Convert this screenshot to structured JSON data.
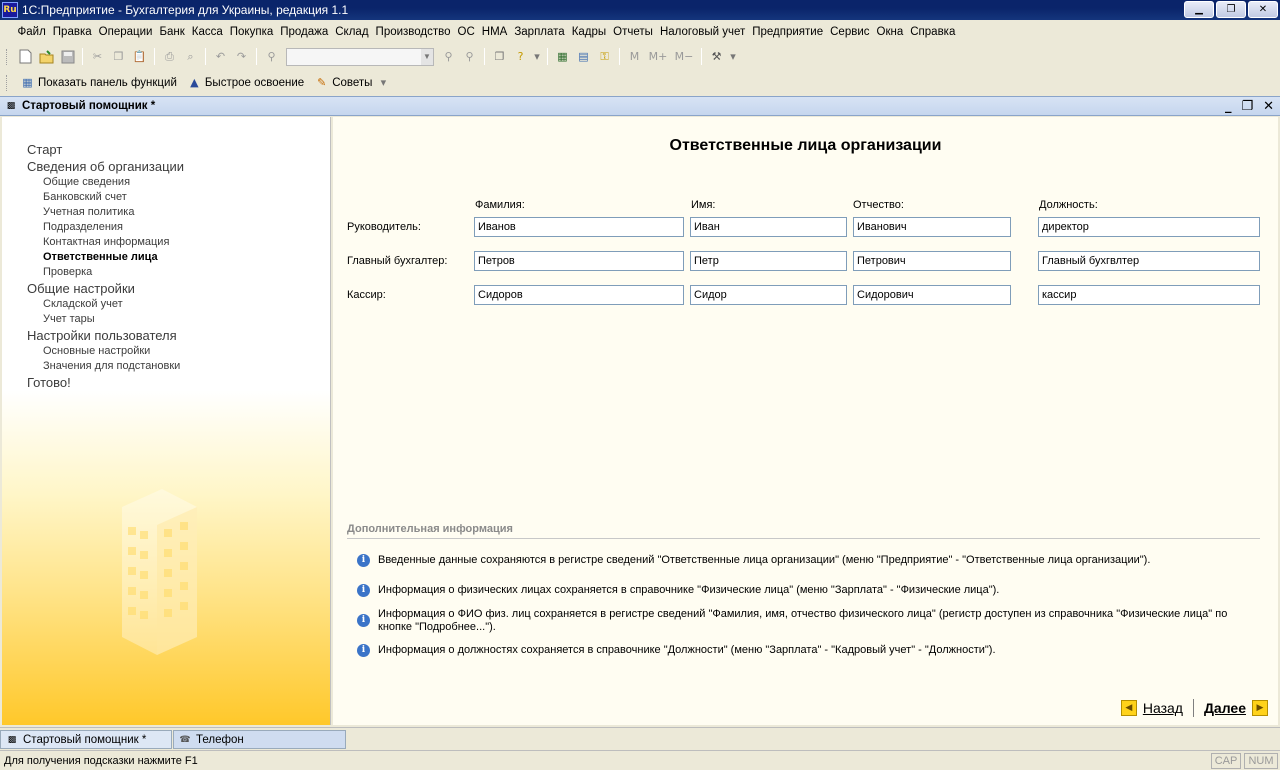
{
  "window": {
    "app_icon_text": "Ru",
    "title": "1С:Предприятие - Бухгалтерия для Украины, редакция 1.1"
  },
  "menu": [
    "Файл",
    "Правка",
    "Операции",
    "Банк",
    "Касса",
    "Покупка",
    "Продажа",
    "Склад",
    "Производство",
    "ОС",
    "НМА",
    "Зарплата",
    "Кадры",
    "Отчеты",
    "Налоговый учет",
    "Предприятие",
    "Сервис",
    "Окна",
    "Справка"
  ],
  "toolbar2": {
    "show_panel": "Показать панель функций",
    "quick_learning": "Быстрое освоение",
    "tips": "Советы"
  },
  "doc_window": {
    "title": "Стартовый помощник *"
  },
  "nav": {
    "start": "Старт",
    "org_info": "Сведения об организации",
    "general_info": "Общие сведения",
    "bank_account": "Банковский счет",
    "accounting_policy": "Учетная политика",
    "departments": "Подразделения",
    "contacts": "Контактная информация",
    "responsible": "Ответственные лица",
    "check": "Проверка",
    "general_settings": "Общие настройки",
    "warehouse": "Складской учет",
    "containers": "Учет тары",
    "user_settings": "Настройки пользователя",
    "basic_settings": "Основные настройки",
    "default_values": "Значения для подстановки",
    "done": "Готово!"
  },
  "main": {
    "title": "Ответственные лица организации",
    "columns": {
      "surname": "Фамилия:",
      "name": "Имя:",
      "patronymic": "Отчество:",
      "position": "Должность:"
    },
    "rows": {
      "director": {
        "label": "Руководитель:",
        "surname": "Иванов",
        "name": "Иван",
        "patronymic": "Иванович",
        "position": "директор"
      },
      "accountant": {
        "label": "Главный бухгалтер:",
        "surname": "Петров",
        "name": "Петр",
        "patronymic": "Петрович",
        "position": "Главный бухгвлтер"
      },
      "cashier": {
        "label": "Кассир:",
        "surname": "Сидоров",
        "name": "Сидор",
        "patronymic": "Сидорович",
        "position": "кассир"
      }
    },
    "additional_title": "Дополнительная информация",
    "info": [
      "Введенные данные сохраняются в регистре сведений \"Ответственные лица организации\" (меню \"Предприятие\" - \"Ответственные лица организации\").",
      "Информация о физических лицах сохраняется в справочнике \"Физические лица\" (меню \"Зарплата\" - \"Физические лица\").",
      "Информация о ФИО физ. лиц сохраняется в регистре сведений \"Фамилия, имя, отчество физического лица\" (регистр доступен из справочника \"Физические лица\" по кнопке \"Подробнее...\").",
      "Информация о должностях сохраняется в справочнике \"Должности\" (меню \"Зарплата\" - \"Кадровый учет\" - \"Должности\")."
    ],
    "back": "Назад",
    "next": "Далее"
  },
  "taskbar": {
    "active": "Стартовый помощник *",
    "phone": "Телефон"
  },
  "status": {
    "hint": "Для получения подсказки нажмите F1",
    "cap": "CAP",
    "num": "NUM"
  },
  "colors": {
    "title_bar": "#0a246a",
    "panel_gradient_end": "#ffc82a",
    "info_icon": "#3b74c8"
  }
}
